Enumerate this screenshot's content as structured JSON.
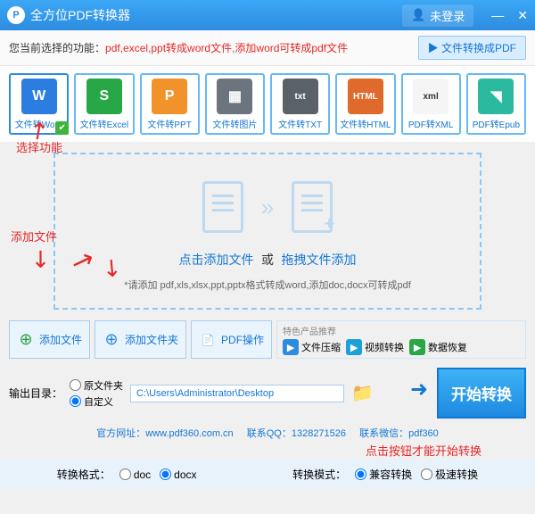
{
  "titlebar": {
    "app_name": "全方位PDF转换器",
    "login": "未登录"
  },
  "subbar": {
    "label": "您当前选择的功能：",
    "hint": "pdf,excel,ppt转成word文件,添加word可转成pdf文件",
    "tab_btn": "文件转换成PDF"
  },
  "tiles": [
    {
      "label": "文件转Word",
      "ico": "W",
      "bg": "#2b7de0"
    },
    {
      "label": "文件转Excel",
      "ico": "S",
      "bg": "#27a745"
    },
    {
      "label": "文件转PPT",
      "ico": "P",
      "bg": "#f0932b"
    },
    {
      "label": "文件转图片",
      "ico": "▦",
      "bg": "#6c757d"
    },
    {
      "label": "文件转TXT",
      "ico": "txt",
      "bg": "#5a6268"
    },
    {
      "label": "文件转HTML",
      "ico": "HTML",
      "bg": "#e06a2b"
    },
    {
      "label": "PDF转XML",
      "ico": "xml",
      "bg": "#f5f5f5",
      "fg": "#333"
    },
    {
      "label": "PDF转Epub",
      "ico": "◥",
      "bg": "#2bbaa0"
    }
  ],
  "annotations": {
    "select_func": "选择功能",
    "add_file": "添加文件",
    "start_hint": "点击按钮才能开始转换"
  },
  "dropzone": {
    "link1": "点击添加文件",
    "or": "或",
    "link2": "拖拽文件添加",
    "note": "*请添加 pdf,xls,xlsx,ppt,pptx格式转成word,添加doc,docx可转成pdf"
  },
  "toolbar": {
    "add_file": "添加文件",
    "add_folder": "添加文件夹",
    "pdf_ops": "PDF操作"
  },
  "promo": {
    "title": "特色产品推荐",
    "items": [
      {
        "label": "文件压缩",
        "bg": "#2d8ce0"
      },
      {
        "label": "视频转换",
        "bg": "#1da0d8"
      },
      {
        "label": "数据恢复",
        "bg": "#27a745"
      }
    ]
  },
  "output": {
    "label": "输出目录：",
    "r1": "原文件夹",
    "r2": "自定义",
    "path": "C:\\Users\\Administrator\\Desktop"
  },
  "start": "开始转换",
  "footer": {
    "l1": "官方网址：www.pdf360.com.cn",
    "l2": "联系QQ：1328271526",
    "l3": "联系微信：pdf360"
  },
  "bottom": {
    "format_label": "转换格式：",
    "f1": "doc",
    "f2": "docx",
    "mode_label": "转换模式：",
    "m1": "兼容转换",
    "m2": "极速转换"
  }
}
